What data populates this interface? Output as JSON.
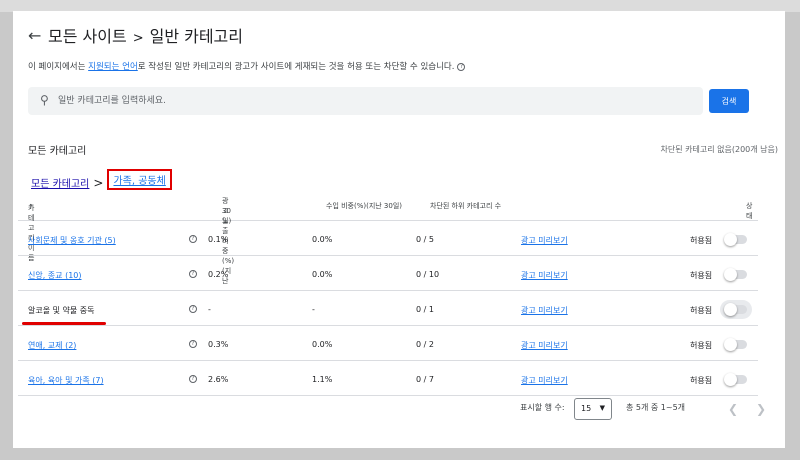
{
  "header": {
    "back_icon": "arrow-left-icon",
    "crumb_root": "모든 사이트",
    "crumb_sep": ">",
    "title": "일반 카테고리"
  },
  "description": {
    "before": "이 페이지에서는 ",
    "link": "지원되는 언어",
    "after": "로 작성된 일반 카테고리의 광고가 사이트에 게재되는 것을 허용 또는 차단할 수 있습니다."
  },
  "search": {
    "placeholder": "일반 카테고리를 입력하세요.",
    "value": "",
    "button_label": "검색"
  },
  "section": {
    "title": "모든 카테고리",
    "status": "차단된 카테고리 없음(200개 남음)"
  },
  "breadcrumb": {
    "root": "모든 카테고리",
    "chevron": ">",
    "current": "가족, 공동체"
  },
  "table": {
    "headers": {
      "name": "카테고리 이름",
      "impressions": "광고 노출 비중(%)(지난",
      "impressions_2": "30일)",
      "revenue": "수입 비중(%)(지난 30일)",
      "blocked": "차단된 하위 카테고리 수",
      "status": "상태"
    },
    "rows": [
      {
        "name": "사회문제 및 옹호 기관 (5)",
        "is_link": true,
        "impressions": "0.1%",
        "revenue": "0.0%",
        "blocked": "0 / 5",
        "preview": "광고 미리보기",
        "status": "허용됨"
      },
      {
        "name": "신앙, 종교 (10)",
        "is_link": true,
        "impressions": "0.2%",
        "revenue": "0.0%",
        "blocked": "0 / 10",
        "preview": "광고 미리보기",
        "status": "허용됨"
      },
      {
        "name": "알코올 및 약물 중독",
        "is_link": false,
        "impressions": "-",
        "revenue": "-",
        "blocked": "0 / 1",
        "preview": "광고 미리보기",
        "status": "허용됨"
      },
      {
        "name": "연애, 교제 (2)",
        "is_link": true,
        "impressions": "0.3%",
        "revenue": "0.0%",
        "blocked": "0 / 2",
        "preview": "광고 미리보기",
        "status": "허용됨"
      },
      {
        "name": "육아, 육아 및 가족 (7)",
        "is_link": true,
        "impressions": "2.6%",
        "revenue": "1.1%",
        "blocked": "0 / 7",
        "preview": "광고 미리보기",
        "status": "허용됨"
      }
    ]
  },
  "pagination": {
    "rows_label": "표시할 행 수:",
    "rows_value": "15",
    "range": "총 5개 중 1~5개",
    "prev_icon": "chevron-left-icon",
    "next_icon": "chevron-right-icon"
  },
  "colors": {
    "accent": "#1a73e8",
    "highlight": "#e00000"
  }
}
